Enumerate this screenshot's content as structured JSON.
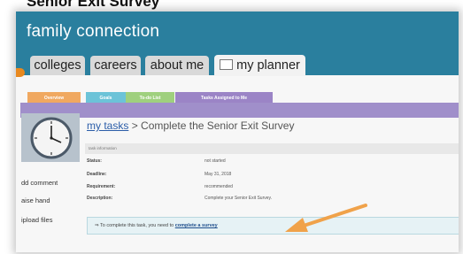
{
  "document": {
    "heading": "Senior Exit Survey"
  },
  "app": {
    "title": "family connection"
  },
  "main_tabs": [
    {
      "label": "colleges"
    },
    {
      "label": "careers"
    },
    {
      "label": "about me"
    },
    {
      "label": "my planner",
      "icon": "planner-icon",
      "active": true
    }
  ],
  "sub_tabs": [
    {
      "label": "Overview",
      "color": "#f0a860"
    },
    {
      "label": "Goals",
      "color": "#6cc3d8"
    },
    {
      "label": "To-do List",
      "color": "#9fd07e"
    },
    {
      "label": "Tasks Assigned to Me",
      "color": "#9b84c6",
      "active": true
    }
  ],
  "breadcrumb": {
    "link": "my tasks",
    "separator": ">",
    "current": "Complete the Senior Exit Survey"
  },
  "task_info": {
    "header": "task information",
    "rows": [
      {
        "label": "Status:",
        "value": "not started"
      },
      {
        "label": "Deadline:",
        "value": "May 31, 2018"
      },
      {
        "label": "Requirement:",
        "value": "recommended"
      },
      {
        "label": "Description:",
        "value": "Complete your Senior Exit Survey."
      }
    ]
  },
  "side_links": [
    "dd comment",
    "aise hand",
    "ipload files"
  ],
  "notice": {
    "arrow": "⇒",
    "text": "To complete this task, you need to",
    "link": "complete a survey"
  },
  "colors": {
    "banner": "#2a7f9e",
    "accent_bar": "#a08fca",
    "annotation_arrow": "#f0a24a"
  }
}
